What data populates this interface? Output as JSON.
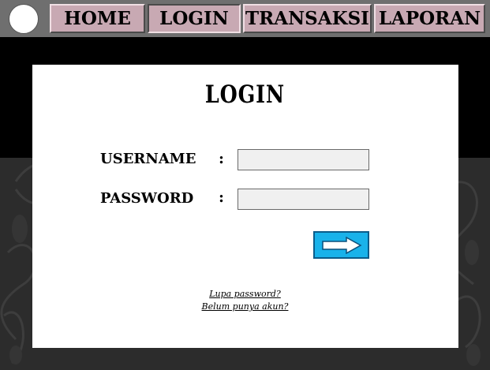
{
  "nav": {
    "items": [
      {
        "label": "HOME"
      },
      {
        "label": "LOGIN"
      },
      {
        "label": "TRANSAKSI"
      },
      {
        "label": "LAPORAN"
      }
    ],
    "active": "LOGIN"
  },
  "login": {
    "title": "LOGIN",
    "username_label": "USERNAME",
    "password_label": "PASSWORD",
    "colon": ":",
    "username_value": "",
    "password_value": "",
    "submit_icon": "arrow-right-icon",
    "forgot_link": "Lupa password?",
    "register_link": "Belum punya akun?"
  },
  "colors": {
    "nav_button": "#c8a9b3",
    "topbar": "#6f6f6f",
    "submit_button": "#19b2ea",
    "panel": "#ffffff",
    "background": "#000000"
  }
}
